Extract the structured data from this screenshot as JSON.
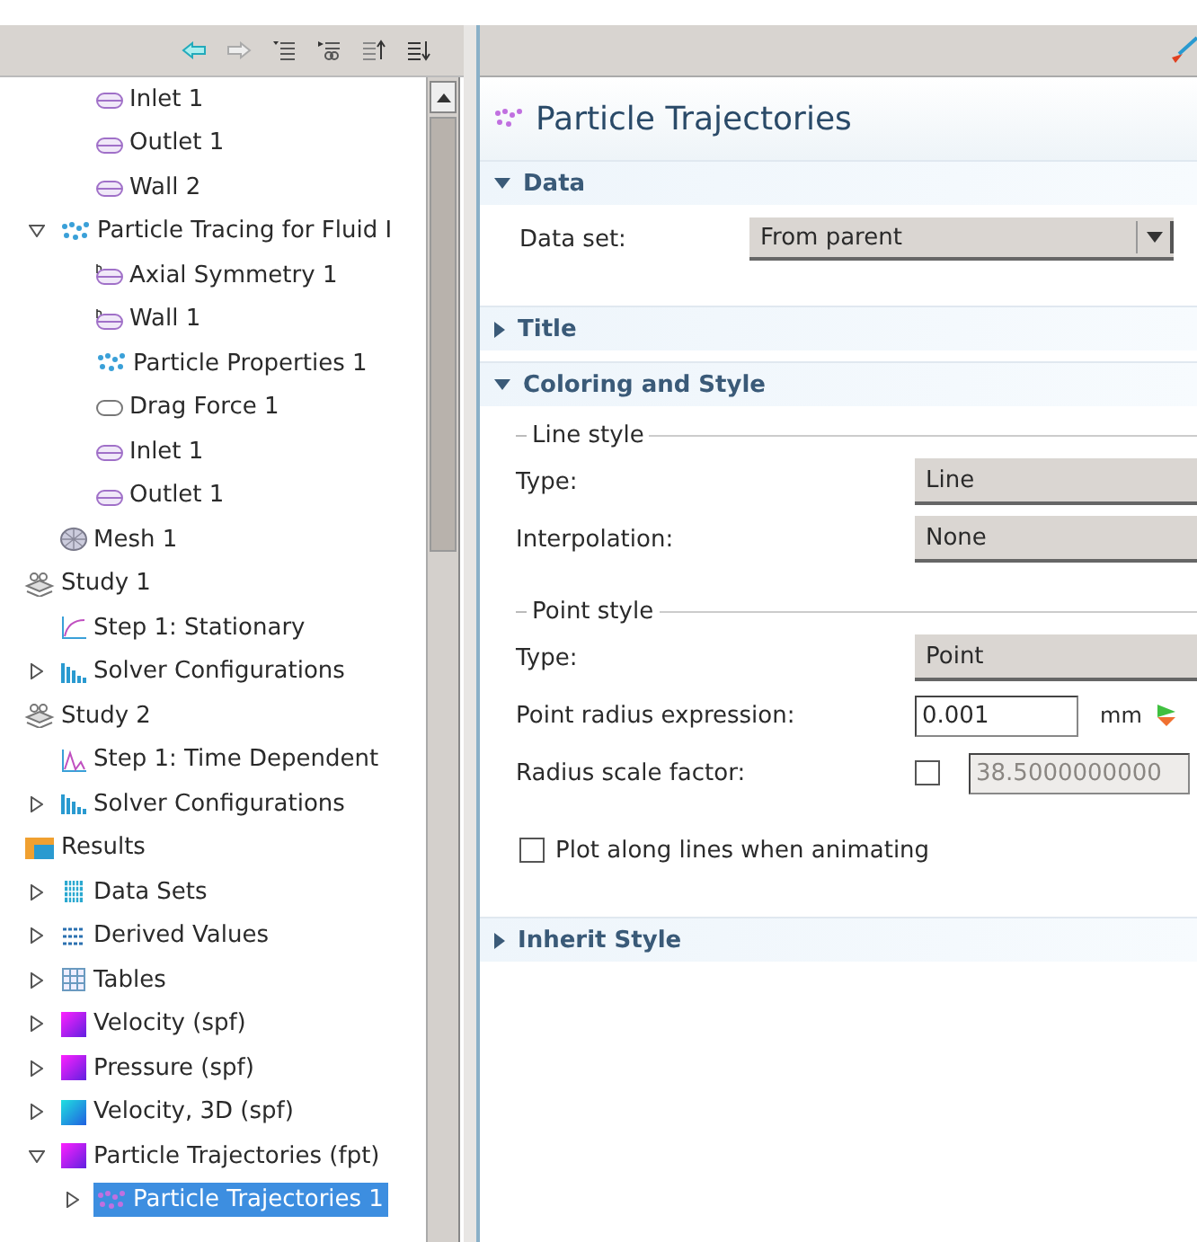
{
  "tree": {
    "nodes": [
      {
        "children": [
          {
            "children": [
              {
                "label": "Inlet 1",
                "kind": "boundary",
                "selected": false
              },
              {
                "label": "Outlet 1",
                "kind": "boundary",
                "selected": false
              },
              {
                "label": "Wall 2",
                "kind": "boundary",
                "selected": false
              }
            ]
          },
          {
            "label": "Particle Tracing for Fluid I",
            "kind": "particles",
            "expanded": true,
            "selected": false,
            "children": [
              {
                "label": "Axial Symmetry 1",
                "kind": "axial",
                "selected": false
              },
              {
                "label": "Wall 1",
                "kind": "axial",
                "selected": false
              },
              {
                "label": "Particle Properties 1",
                "kind": "particles",
                "selected": false
              },
              {
                "label": "Drag Force 1",
                "kind": "drag",
                "selected": false
              },
              {
                "label": "Inlet 1",
                "kind": "boundary",
                "selected": false
              },
              {
                "label": "Outlet 1",
                "kind": "boundary",
                "selected": false
              }
            ]
          },
          {
            "label": "Mesh 1",
            "kind": "mesh",
            "selected": false
          }
        ]
      },
      {
        "label": "Study 1",
        "kind": "study",
        "selected": false,
        "children": [
          {
            "label": "Step 1: Stationary",
            "kind": "stationary",
            "selected": false
          },
          {
            "label": "Solver Configurations",
            "kind": "solver",
            "expanded": false,
            "selected": false
          }
        ]
      },
      {
        "label": "Study 2",
        "kind": "study",
        "selected": false,
        "children": [
          {
            "label": "Step 1: Time Dependent",
            "kind": "timedep",
            "selected": false
          },
          {
            "label": "Solver Configurations",
            "kind": "solver",
            "expanded": false,
            "selected": false
          }
        ]
      },
      {
        "label": "Results",
        "kind": "results",
        "selected": false,
        "children": [
          {
            "label": "Data Sets",
            "kind": "datasets",
            "expanded": false,
            "selected": false
          },
          {
            "label": "Derived Values",
            "kind": "derived",
            "expanded": false,
            "selected": false
          },
          {
            "label": "Tables",
            "kind": "tables",
            "expanded": false,
            "selected": false
          },
          {
            "label": "Velocity (spf)",
            "kind": "plot",
            "expanded": false,
            "selected": false
          },
          {
            "label": "Pressure (spf)",
            "kind": "plot",
            "expanded": false,
            "selected": false
          },
          {
            "label": "Velocity, 3D (spf)",
            "kind": "plot3d",
            "expanded": false,
            "selected": false
          },
          {
            "label": "Particle Trajectories (fpt)",
            "kind": "plot",
            "expanded": true,
            "selected": false,
            "children": [
              {
                "label": "Particle Trajectories 1",
                "kind": "trajectories",
                "expanded": false,
                "selected": true
              }
            ]
          }
        ]
      }
    ]
  },
  "settings": {
    "title": "Particle Trajectories",
    "sections": [
      {
        "title": "Data",
        "expanded": true,
        "groups": [
          {
            "rows": [
              {
                "kind": "dropdown",
                "label": "Data set:",
                "value": "From parent"
              }
            ]
          }
        ]
      },
      {
        "title": "Title",
        "expanded": false
      },
      {
        "title": "Coloring and Style",
        "expanded": true,
        "groups": [
          {
            "legend": "Line style",
            "rows": [
              {
                "kind": "select",
                "label": "Type:",
                "value": "Line"
              },
              {
                "kind": "select",
                "label": "Interpolation:",
                "value": "None"
              }
            ]
          },
          {
            "legend": "Point style",
            "rows": [
              {
                "kind": "select",
                "label": "Type:",
                "value": "Point"
              },
              {
                "kind": "expression",
                "label": "Point radius expression:",
                "value": "0.001",
                "unit": "mm"
              },
              {
                "kind": "scale",
                "label": "Radius scale factor:",
                "checked": false,
                "value": "38.5000000000"
              }
            ]
          },
          {
            "rows": [
              {
                "kind": "checkbox",
                "label": "Plot along lines when animating",
                "checked": false
              }
            ]
          }
        ]
      },
      {
        "title": "Inherit Style",
        "expanded": false
      }
    ]
  }
}
